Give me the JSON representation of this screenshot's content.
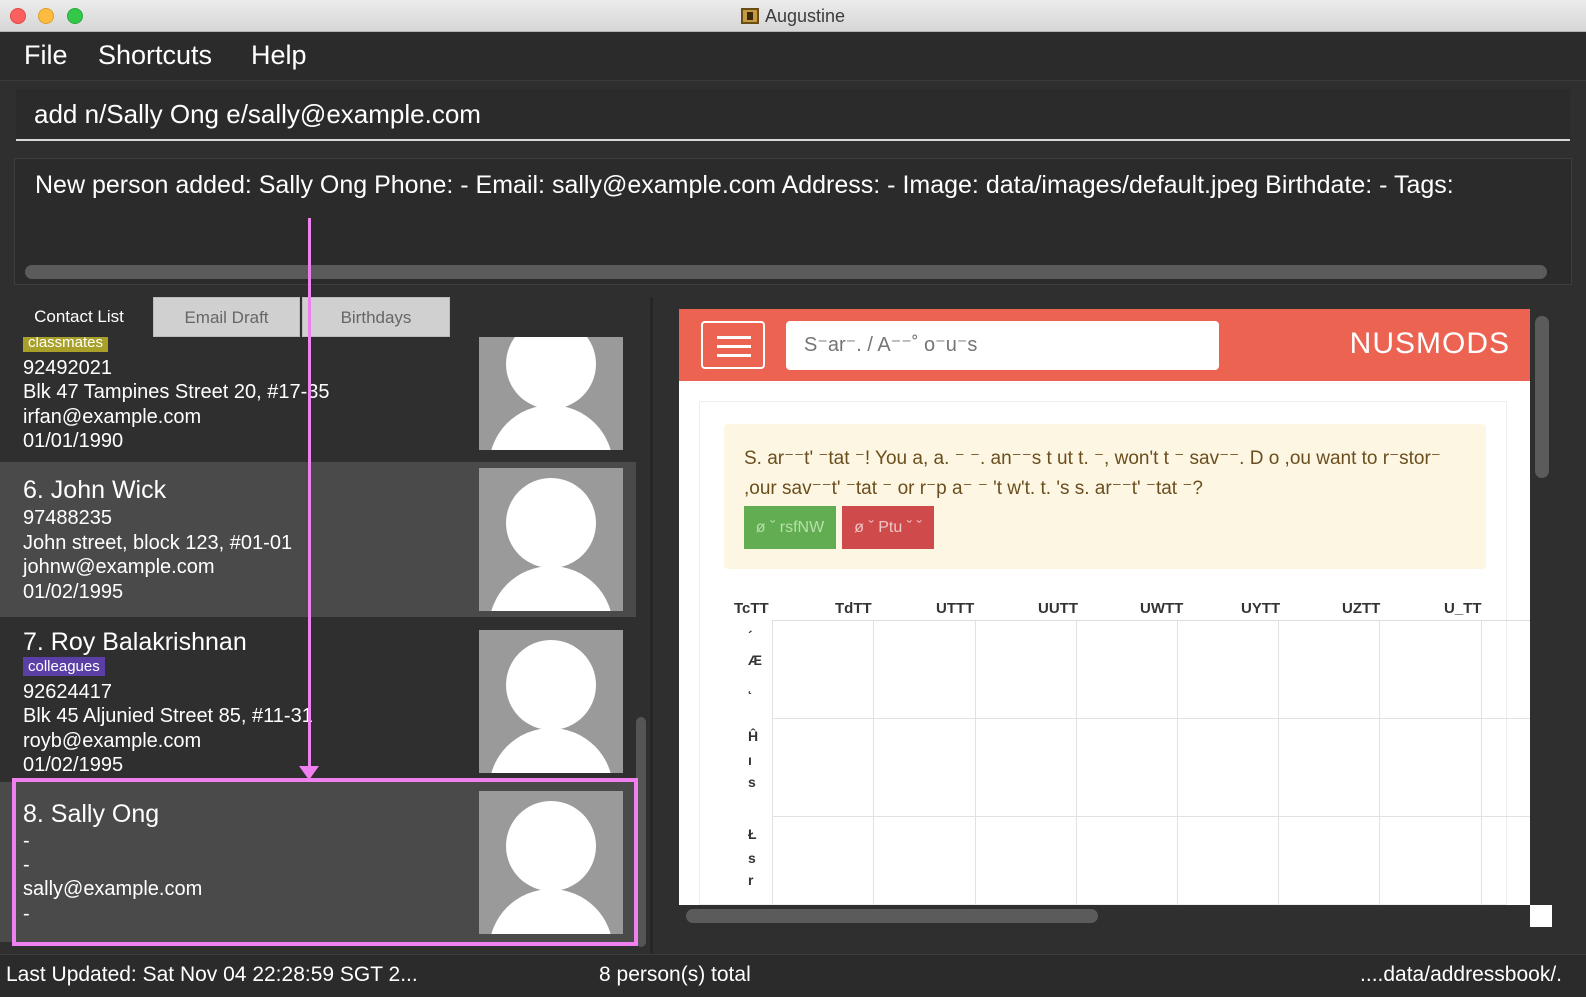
{
  "window": {
    "title": "Augustine"
  },
  "menu": {
    "file": "File",
    "shortcuts": "Shortcuts",
    "help": "Help"
  },
  "command": {
    "value": "add n/Sally Ong e/sally@example.com"
  },
  "result": {
    "text": "New person added: Sally Ong Phone: - Email: sally@example.com Address: - Image: data/images/default.jpeg Birthdate: - Tags:"
  },
  "tabs": {
    "contact_list": "Contact List",
    "email_draft": "Email Draft",
    "birthdays": "Birthdays"
  },
  "contacts": [
    {
      "tag": "classmates",
      "tag_color": "#a8a028",
      "phone": "92492021",
      "address": "Blk 47 Tampines Street 20, #17-35",
      "email": "irfan@example.com",
      "birthdate": "01/01/1990"
    },
    {
      "index_name": "6.  John Wick",
      "phone": "97488235",
      "address": "John street, block 123, #01-01",
      "email": "johnw@example.com",
      "birthdate": "01/02/1995"
    },
    {
      "index_name": "7.  Roy Balakrishnan",
      "tag": "colleagues",
      "tag_color": "#5b3fa6",
      "phone": "92624417",
      "address": "Blk 45 Aljunied Street 85, #11-31",
      "email": "royb@example.com",
      "birthdate": "01/02/1995"
    },
    {
      "index_name": "8.  Sally Ong",
      "phone": "-",
      "address": "-",
      "email": "sally@example.com",
      "birthdate": "-"
    }
  ],
  "browser": {
    "search_placeholder": "S⁻ar⁻. / A⁻⁻˚ o⁻u⁻s",
    "logo": "NUSMODS",
    "alert_text": "S. ar⁻⁻t'  ⁻tat ⁻! You   a,    a. ⁻ ⁻. an⁻⁻s t ut t. ⁻, won't t ⁻ sav⁻⁻. D o ,ou want to r⁻stor⁻ ,our sav⁻⁻t'  ⁻tat  ⁻ or r⁻p a⁻ ⁻ 't w't. t. 's s. ar⁻⁻t'  ⁻tat  ⁻?",
    "btn_green": "ø ˇ rsfNW",
    "btn_red": "ø ˇ Ptu ˇ ˇ",
    "days": [
      "TcTT",
      "TdTT",
      "UTTT",
      "UUTT",
      "UWTT",
      "UYTT",
      "UZTT",
      "U_TT"
    ],
    "side_labels": [
      "´",
      "Æ",
      "˛",
      "Ĥ",
      "ı",
      "s",
      "Ł",
      "s",
      "r"
    ]
  },
  "status": {
    "last_updated": "Last Updated: Sat Nov 04 22:28:59 SGT 2...",
    "total": "8 person(s) total",
    "path": "....data/addressbook/."
  },
  "colors": {
    "annotation": "#f07ff0",
    "nusmods_header": "#ec6352"
  }
}
